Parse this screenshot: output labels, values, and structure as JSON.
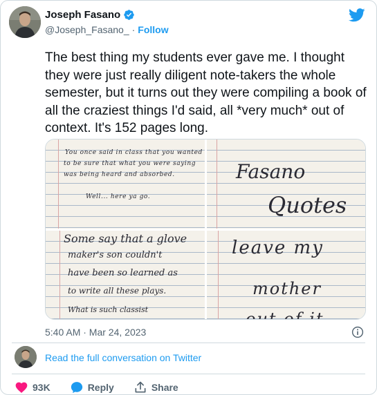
{
  "author": {
    "name": "Joseph Fasano",
    "handle": "@Joseph_Fasano_",
    "separator": "·",
    "follow_label": "Follow"
  },
  "tweet": {
    "text": "The best thing my students ever gave me.  I thought they were just really diligent note-takers the whole semester, but it turns out they were compiling a book of all the craziest things I'd said, all *very much* out of context.  It's 152 pages long.",
    "timestamp": "5:40 AM · Mar 24, 2023"
  },
  "media": {
    "image1_lines": [
      "You once said in class that you wanted",
      "to be sure that what you were saying",
      "was being heard and absorbed.",
      "Well... here ya go."
    ],
    "image2_lines": [
      "Fasano",
      "Quotes"
    ],
    "image3_lines": [
      "Some say that a glove",
      "maker's son couldn't",
      "have been so learned as",
      "to write all these plays.",
      "What is such classist"
    ],
    "image4_lines": [
      "leave my",
      "mother",
      "out of it"
    ]
  },
  "conversation": {
    "link_label": "Read the full conversation on Twitter"
  },
  "actions": {
    "like_count": "93K",
    "reply_label": "Reply",
    "share_label": "Share"
  },
  "colors": {
    "accent": "#1d9bf0",
    "like": "#f91880",
    "secondary_text": "#536471"
  }
}
